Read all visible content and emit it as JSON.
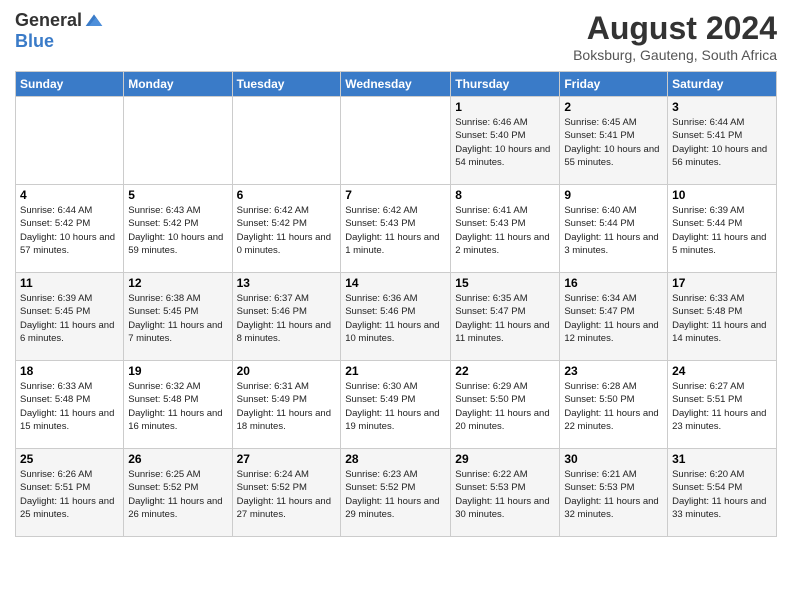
{
  "header": {
    "logo_general": "General",
    "logo_blue": "Blue",
    "month_title": "August 2024",
    "location": "Boksburg, Gauteng, South Africa"
  },
  "days_of_week": [
    "Sunday",
    "Monday",
    "Tuesday",
    "Wednesday",
    "Thursday",
    "Friday",
    "Saturday"
  ],
  "weeks": [
    [
      {
        "day": "",
        "info": ""
      },
      {
        "day": "",
        "info": ""
      },
      {
        "day": "",
        "info": ""
      },
      {
        "day": "",
        "info": ""
      },
      {
        "day": "1",
        "info": "Sunrise: 6:46 AM\nSunset: 5:40 PM\nDaylight: 10 hours and 54 minutes."
      },
      {
        "day": "2",
        "info": "Sunrise: 6:45 AM\nSunset: 5:41 PM\nDaylight: 10 hours and 55 minutes."
      },
      {
        "day": "3",
        "info": "Sunrise: 6:44 AM\nSunset: 5:41 PM\nDaylight: 10 hours and 56 minutes."
      }
    ],
    [
      {
        "day": "4",
        "info": "Sunrise: 6:44 AM\nSunset: 5:42 PM\nDaylight: 10 hours and 57 minutes."
      },
      {
        "day": "5",
        "info": "Sunrise: 6:43 AM\nSunset: 5:42 PM\nDaylight: 10 hours and 59 minutes."
      },
      {
        "day": "6",
        "info": "Sunrise: 6:42 AM\nSunset: 5:42 PM\nDaylight: 11 hours and 0 minutes."
      },
      {
        "day": "7",
        "info": "Sunrise: 6:42 AM\nSunset: 5:43 PM\nDaylight: 11 hours and 1 minute."
      },
      {
        "day": "8",
        "info": "Sunrise: 6:41 AM\nSunset: 5:43 PM\nDaylight: 11 hours and 2 minutes."
      },
      {
        "day": "9",
        "info": "Sunrise: 6:40 AM\nSunset: 5:44 PM\nDaylight: 11 hours and 3 minutes."
      },
      {
        "day": "10",
        "info": "Sunrise: 6:39 AM\nSunset: 5:44 PM\nDaylight: 11 hours and 5 minutes."
      }
    ],
    [
      {
        "day": "11",
        "info": "Sunrise: 6:39 AM\nSunset: 5:45 PM\nDaylight: 11 hours and 6 minutes."
      },
      {
        "day": "12",
        "info": "Sunrise: 6:38 AM\nSunset: 5:45 PM\nDaylight: 11 hours and 7 minutes."
      },
      {
        "day": "13",
        "info": "Sunrise: 6:37 AM\nSunset: 5:46 PM\nDaylight: 11 hours and 8 minutes."
      },
      {
        "day": "14",
        "info": "Sunrise: 6:36 AM\nSunset: 5:46 PM\nDaylight: 11 hours and 10 minutes."
      },
      {
        "day": "15",
        "info": "Sunrise: 6:35 AM\nSunset: 5:47 PM\nDaylight: 11 hours and 11 minutes."
      },
      {
        "day": "16",
        "info": "Sunrise: 6:34 AM\nSunset: 5:47 PM\nDaylight: 11 hours and 12 minutes."
      },
      {
        "day": "17",
        "info": "Sunrise: 6:33 AM\nSunset: 5:48 PM\nDaylight: 11 hours and 14 minutes."
      }
    ],
    [
      {
        "day": "18",
        "info": "Sunrise: 6:33 AM\nSunset: 5:48 PM\nDaylight: 11 hours and 15 minutes."
      },
      {
        "day": "19",
        "info": "Sunrise: 6:32 AM\nSunset: 5:48 PM\nDaylight: 11 hours and 16 minutes."
      },
      {
        "day": "20",
        "info": "Sunrise: 6:31 AM\nSunset: 5:49 PM\nDaylight: 11 hours and 18 minutes."
      },
      {
        "day": "21",
        "info": "Sunrise: 6:30 AM\nSunset: 5:49 PM\nDaylight: 11 hours and 19 minutes."
      },
      {
        "day": "22",
        "info": "Sunrise: 6:29 AM\nSunset: 5:50 PM\nDaylight: 11 hours and 20 minutes."
      },
      {
        "day": "23",
        "info": "Sunrise: 6:28 AM\nSunset: 5:50 PM\nDaylight: 11 hours and 22 minutes."
      },
      {
        "day": "24",
        "info": "Sunrise: 6:27 AM\nSunset: 5:51 PM\nDaylight: 11 hours and 23 minutes."
      }
    ],
    [
      {
        "day": "25",
        "info": "Sunrise: 6:26 AM\nSunset: 5:51 PM\nDaylight: 11 hours and 25 minutes."
      },
      {
        "day": "26",
        "info": "Sunrise: 6:25 AM\nSunset: 5:52 PM\nDaylight: 11 hours and 26 minutes."
      },
      {
        "day": "27",
        "info": "Sunrise: 6:24 AM\nSunset: 5:52 PM\nDaylight: 11 hours and 27 minutes."
      },
      {
        "day": "28",
        "info": "Sunrise: 6:23 AM\nSunset: 5:52 PM\nDaylight: 11 hours and 29 minutes."
      },
      {
        "day": "29",
        "info": "Sunrise: 6:22 AM\nSunset: 5:53 PM\nDaylight: 11 hours and 30 minutes."
      },
      {
        "day": "30",
        "info": "Sunrise: 6:21 AM\nSunset: 5:53 PM\nDaylight: 11 hours and 32 minutes."
      },
      {
        "day": "31",
        "info": "Sunrise: 6:20 AM\nSunset: 5:54 PM\nDaylight: 11 hours and 33 minutes."
      }
    ]
  ]
}
